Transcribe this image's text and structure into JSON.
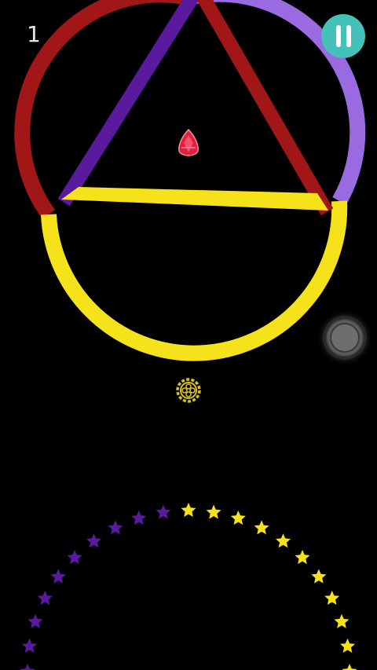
{
  "hud": {
    "score": "1",
    "pause_icon": "pause-icon",
    "pause_color": "#44c2b9",
    "float_button_icon": "circle-icon"
  },
  "game": {
    "colors": {
      "red": "#a11616",
      "purple_light": "#9a6be0",
      "purple_dark": "#5a1a9e",
      "yellow": "#f5e21a",
      "gem": "#e02040"
    },
    "obstacles": {
      "ring": "ring-obstacle",
      "triangle": "triangle-obstacle",
      "star_ring": "star-ring-obstacle"
    },
    "player_icon": "gem-icon",
    "switcher_icon": "color-switcher-icon"
  }
}
